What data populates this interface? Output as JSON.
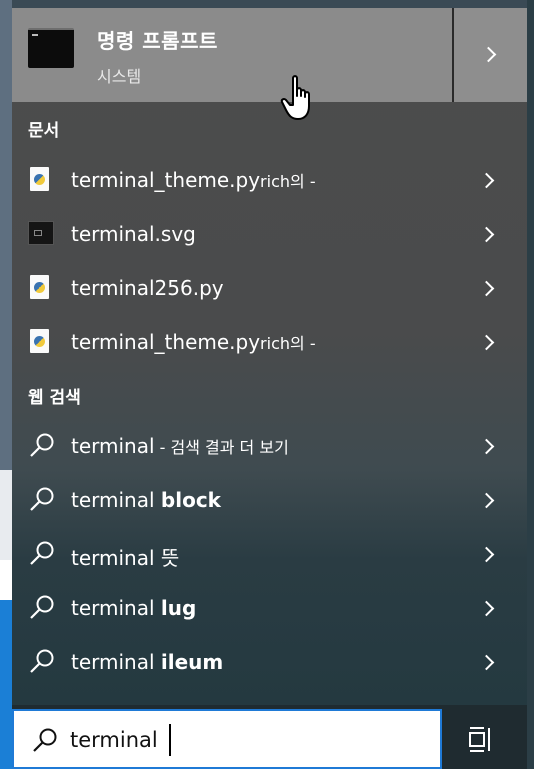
{
  "best_match": {
    "title": "명령 프롬프트",
    "subtitle": "시스템",
    "icon": "cmd-icon"
  },
  "sections": {
    "documents": "문서",
    "web_search": "웹 검색"
  },
  "documents": [
    {
      "name": "terminal_theme.py",
      "suffix": "rich",
      "suffix2": "의 -",
      "icon": "python-file-icon"
    },
    {
      "name": "terminal.svg",
      "suffix": "",
      "suffix2": "",
      "icon": "svg-file-icon"
    },
    {
      "name": "terminal256.py",
      "suffix": "",
      "suffix2": "",
      "icon": "python-file-icon"
    },
    {
      "name": "terminal_theme.py",
      "suffix": "rich",
      "suffix2": "의 -",
      "icon": "python-file-icon"
    }
  ],
  "web": [
    {
      "query": "terminal",
      "bold": "",
      "extra": " - 검색 결과 더 보기"
    },
    {
      "query": "terminal ",
      "bold": "block",
      "extra": ""
    },
    {
      "query": "terminal 뜻",
      "bold": "",
      "extra": ""
    },
    {
      "query": "terminal ",
      "bold": "lug",
      "extra": ""
    },
    {
      "query": "terminal ",
      "bold": "ileum",
      "extra": ""
    }
  ],
  "search": {
    "value": "terminal",
    "icon": "search-icon"
  },
  "taskbar": {
    "icon": "task-view-icon"
  },
  "colors": {
    "accent": "#1f7ad6",
    "best_match_bg": "#8b8b8b"
  }
}
